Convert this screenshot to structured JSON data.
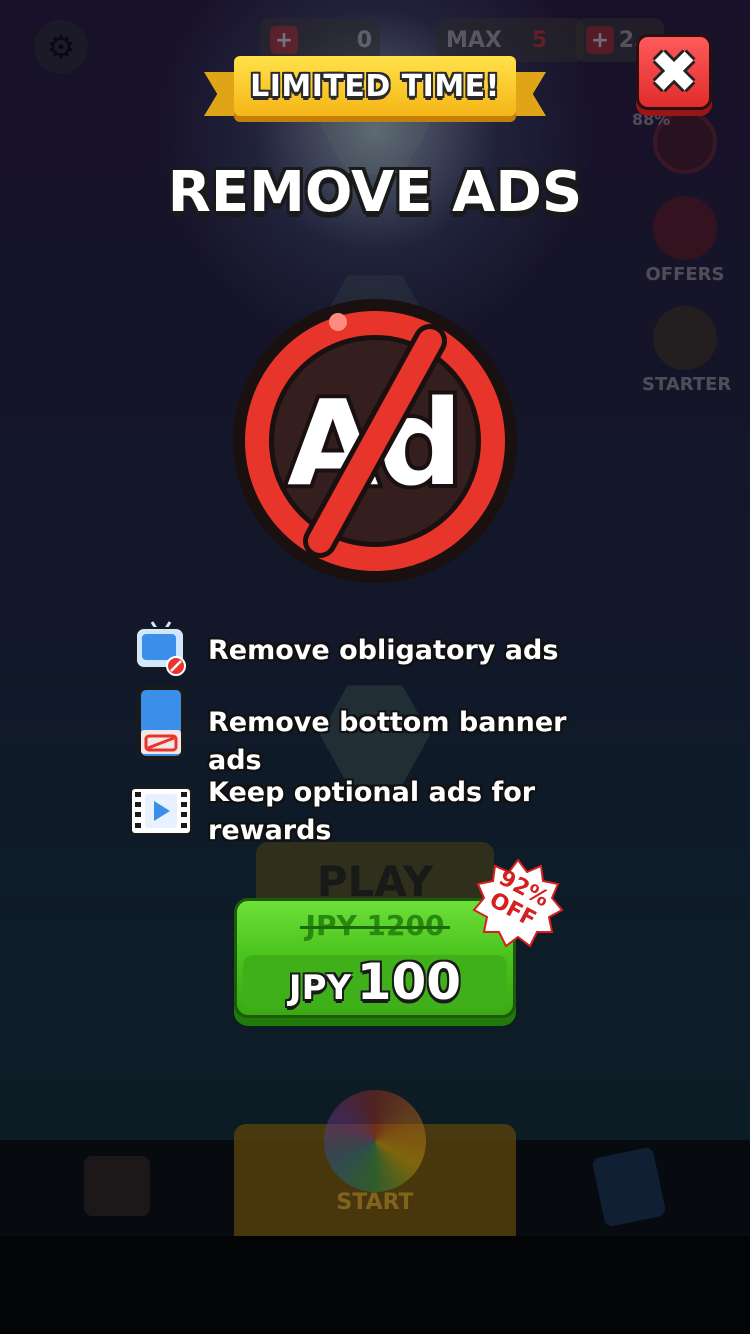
{
  "hud": {
    "coins_value": "0",
    "lives_label": "MAX",
    "lives_count": "5",
    "gems_value": "2…"
  },
  "side_menu": {
    "discount_tag": "88%",
    "offers_label": "OFFERS",
    "starter_label": "STARTER"
  },
  "background": {
    "play_label": "PLAY",
    "start_label": "START"
  },
  "popup": {
    "banner_label": "LIMITED TIME!",
    "title": "REMOVE ADS",
    "ad_icon_text": "Ad",
    "features": [
      {
        "icon": "tv-no-ads-icon",
        "text": "Remove obligatory ads"
      },
      {
        "icon": "phone-banner-icon",
        "text": "Remove bottom banner ads"
      },
      {
        "icon": "video-play-icon",
        "text": "Keep optional ads for rewards"
      }
    ],
    "price": {
      "old": "JPY 1200",
      "currency": "JPY",
      "amount": "100"
    },
    "discount_badge": {
      "line1": "92%",
      "line2": "OFF"
    }
  },
  "colors": {
    "accent_green": "#4cc51f",
    "close_red": "#e02c2c",
    "banner_yellow": "#f5b516",
    "prohibit_red": "#e8352c"
  }
}
